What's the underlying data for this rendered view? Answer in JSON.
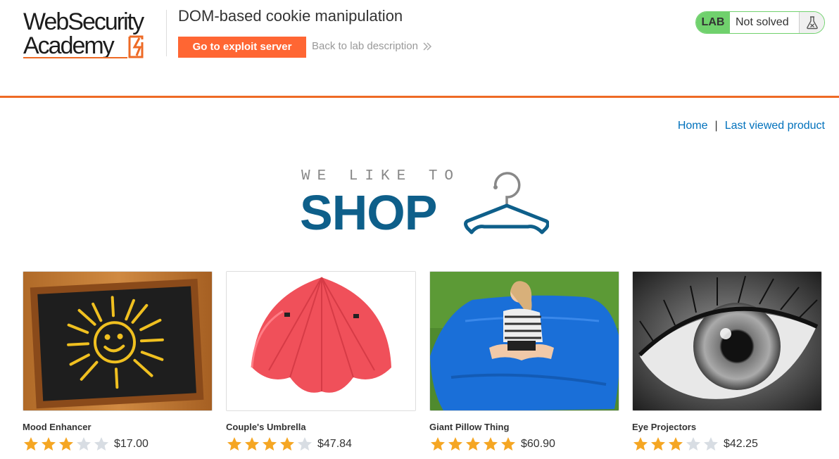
{
  "header": {
    "logo_line1": "WebSecurity",
    "logo_line2": "Academy",
    "lab_title": "DOM-based cookie manipulation",
    "exploit_button": "Go to exploit server",
    "back_link": "Back to lab description",
    "status_badge": "LAB",
    "status_text": "Not solved",
    "accent": "#ff6633",
    "status_color": "#70d16d"
  },
  "nav": {
    "home": "Home",
    "separator": "|",
    "last_viewed": "Last viewed product",
    "link_color": "#0071bc"
  },
  "banner": {
    "small": "WE LIKE TO",
    "big": "SHOP",
    "icon": "hanger-icon",
    "color": "#0e5f8a"
  },
  "products": [
    {
      "name": "Mood Enhancer",
      "price": "$17.00",
      "rating": 3,
      "image": "chalkboard-sun"
    },
    {
      "name": "Couple's Umbrella",
      "price": "$47.84",
      "rating": 4,
      "image": "red-umbrella"
    },
    {
      "name": "Giant Pillow Thing",
      "price": "$60.90",
      "rating": 5,
      "image": "blue-pillow-girl"
    },
    {
      "name": "Eye Projectors",
      "price": "$42.25",
      "rating": 3,
      "image": "eye-closeup"
    }
  ]
}
